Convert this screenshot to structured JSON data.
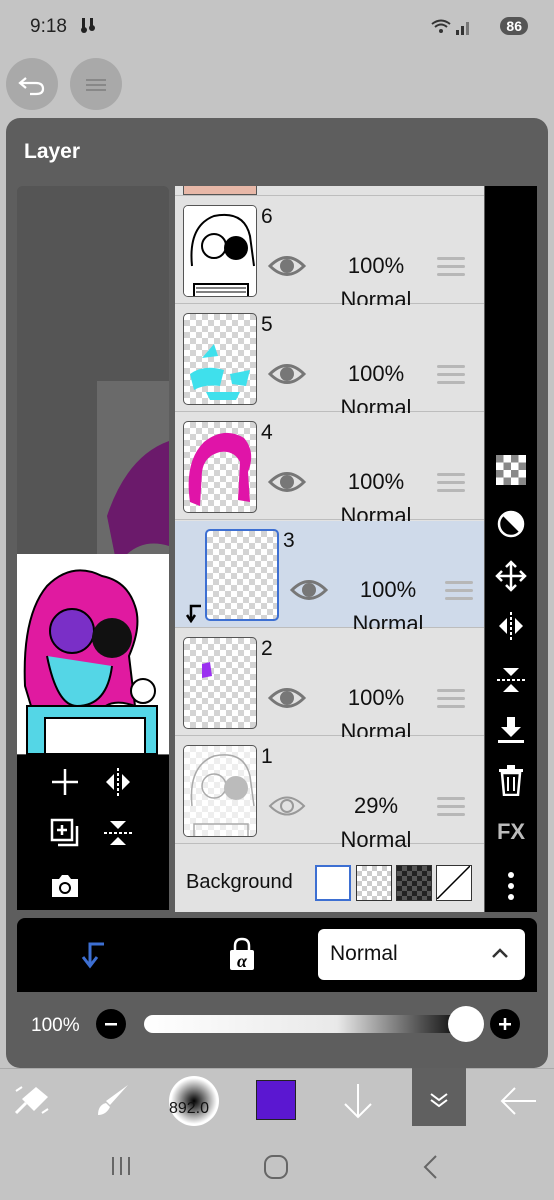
{
  "status_bar": {
    "time": "9:18",
    "battery": "86"
  },
  "panel": {
    "title": "Layer"
  },
  "layers": [
    {
      "number": "6",
      "opacity": "100%",
      "blend": "Normal"
    },
    {
      "number": "5",
      "opacity": "100%",
      "blend": "Normal"
    },
    {
      "number": "4",
      "opacity": "100%",
      "blend": "Normal"
    },
    {
      "number": "3",
      "opacity": "100%",
      "blend": "Normal"
    },
    {
      "number": "2",
      "opacity": "100%",
      "blend": "Normal"
    },
    {
      "number": "1",
      "opacity": "29%",
      "blend": "Normal"
    }
  ],
  "background_label": "Background",
  "right_toolbar": {
    "fx_label": "FX"
  },
  "blend_mode_select": {
    "value": "Normal"
  },
  "opacity_control": {
    "value_label": "100%",
    "value": 1.0
  },
  "main_toolbar": {
    "brush_size": "892.0",
    "color": "#5b17d1"
  },
  "colors": {
    "accent": "#3d6fd2",
    "selected_row": "#cfdaea"
  }
}
